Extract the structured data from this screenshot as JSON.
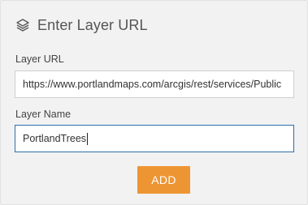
{
  "header": {
    "icon": "layers-icon",
    "title": "Enter Layer URL"
  },
  "layer_url": {
    "label": "Layer URL",
    "value": "https://www.portlandmaps.com/arcgis/rest/services/Public"
  },
  "layer_name": {
    "label": "Layer Name",
    "value": "PortlandTrees"
  },
  "add_button": {
    "label": "ADD"
  },
  "colors": {
    "accent": "#ee9533",
    "focus_border": "#2e6fa8",
    "panel_background": "#f2f2f2"
  }
}
